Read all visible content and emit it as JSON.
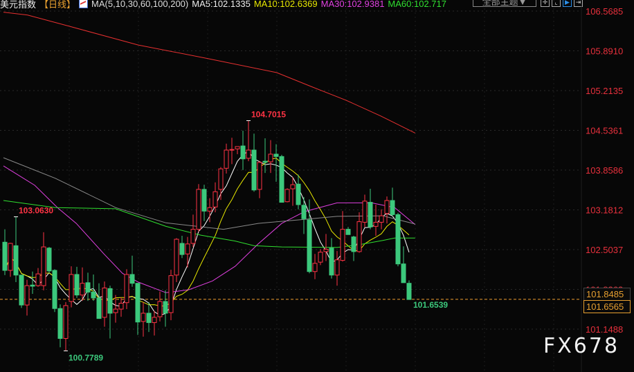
{
  "header": {
    "title": "美元指数",
    "period": "【日线】",
    "ma_icon": "ma-indicator-icon",
    "ma_params": "MA(5,10,30,60,100,200)",
    "ma5": "MA5:102.1335",
    "ma10": "MA10:102.6369",
    "ma30": "MA30:102.9381",
    "ma60": "MA60:102.717"
  },
  "toolbar": {
    "theme_select": "全部主题▼",
    "icons": [
      "crosshair-icon",
      "axis-icon",
      "play-icon",
      "expand-icon"
    ]
  },
  "price_boxes": {
    "upper": "101.8485",
    "lower": "101.6565"
  },
  "watermark": "FX678",
  "colors": {
    "up": "#ff3344",
    "down": "#3cc87c",
    "ma5": "#ffffff",
    "ma10": "#e8e800",
    "ma30": "#e040e0",
    "ma60": "#30e030",
    "ma100": "#8a8a8a",
    "ma200": "#e83030",
    "last_line": "#f0a030"
  },
  "chart_data": {
    "type": "candlestick",
    "title": "美元指数【日线】",
    "ylim": [
      100.6,
      106.62
    ],
    "y_ticks": [
      "106.5685",
      "105.8910",
      "105.2135",
      "104.5361",
      "103.8586",
      "103.1812",
      "102.5037",
      "101.8263",
      "101.1488"
    ],
    "grid": true,
    "last_price_line": 101.6565,
    "annotations": [
      {
        "text": "104.7015",
        "index": 44,
        "price": 104.7015,
        "kind": "high"
      },
      {
        "text": "103.0630",
        "index": 2,
        "price": 103.063,
        "kind": "high"
      },
      {
        "text": "100.7789",
        "index": 11,
        "price": 100.7789,
        "kind": "low"
      },
      {
        "text": "101.6539",
        "index": 73,
        "price": 101.6539,
        "kind": "last"
      }
    ],
    "ohlc": [
      [
        102.63,
        102.85,
        102.07,
        102.15
      ],
      [
        102.15,
        102.62,
        102.04,
        102.61
      ],
      [
        102.57,
        103.06,
        101.95,
        102.07
      ],
      [
        102.07,
        102.07,
        101.51,
        101.56
      ],
      [
        101.56,
        101.99,
        101.38,
        101.89
      ],
      [
        101.9,
        102.13,
        101.75,
        101.88
      ],
      [
        101.89,
        102.19,
        101.87,
        102.09
      ],
      [
        101.89,
        102.8,
        101.81,
        102.55
      ],
      [
        102.53,
        102.55,
        102.1,
        102.14
      ],
      [
        102.15,
        102.17,
        101.44,
        101.5
      ],
      [
        101.5,
        101.57,
        100.84,
        100.99
      ],
      [
        100.99,
        101.61,
        100.78,
        101.55
      ],
      [
        101.62,
        102.22,
        101.52,
        102.08
      ],
      [
        102.08,
        102.21,
        101.68,
        101.73
      ],
      [
        101.73,
        102.2,
        101.63,
        101.93
      ],
      [
        101.94,
        102.11,
        101.63,
        101.78
      ],
      [
        101.78,
        102.08,
        101.63,
        101.68
      ],
      [
        101.68,
        101.93,
        101.33,
        101.33
      ],
      [
        101.35,
        101.96,
        101.19,
        101.85
      ],
      [
        101.84,
        101.89,
        100.99,
        101.42
      ],
      [
        101.43,
        101.73,
        101.26,
        101.49
      ],
      [
        101.49,
        101.69,
        101.36,
        101.59
      ],
      [
        101.6,
        102.17,
        101.49,
        102.08
      ],
      [
        102.08,
        102.4,
        101.87,
        101.93
      ],
      [
        101.93,
        101.93,
        101.05,
        101.27
      ],
      [
        101.28,
        101.61,
        101.02,
        101.42
      ],
      [
        101.42,
        101.61,
        101.1,
        101.26
      ],
      [
        101.26,
        101.46,
        101.04,
        101.35
      ],
      [
        101.36,
        101.79,
        101.28,
        101.62
      ],
      [
        101.62,
        101.81,
        101.19,
        101.42
      ],
      [
        101.43,
        102.16,
        101.3,
        102.06
      ],
      [
        102.07,
        102.7,
        101.95,
        102.68
      ],
      [
        102.61,
        102.74,
        102.36,
        102.42
      ],
      [
        102.43,
        102.72,
        102.2,
        102.6
      ],
      [
        102.61,
        103.1,
        102.55,
        102.85
      ],
      [
        102.85,
        103.62,
        102.81,
        103.53
      ],
      [
        103.53,
        103.61,
        102.99,
        103.16
      ],
      [
        103.16,
        103.38,
        102.97,
        103.22
      ],
      [
        103.23,
        103.65,
        103.14,
        103.49
      ],
      [
        103.53,
        103.91,
        103.35,
        103.88
      ],
      [
        103.89,
        104.31,
        103.8,
        104.2
      ],
      [
        104.2,
        104.41,
        103.96,
        104.21
      ],
      [
        104.22,
        104.26,
        104.13,
        104.26
      ],
      [
        104.27,
        104.53,
        103.86,
        104.05
      ],
      [
        104.06,
        104.7,
        104.01,
        104.2
      ],
      [
        104.2,
        104.48,
        103.49,
        103.52
      ],
      [
        103.53,
        104.01,
        103.38,
        103.99
      ],
      [
        104.01,
        104.4,
        103.81,
        103.99
      ],
      [
        104.0,
        104.37,
        103.81,
        104.13
      ],
      [
        104.13,
        104.3,
        103.66,
        104.09
      ],
      [
        104.09,
        104.12,
        103.31,
        103.31
      ],
      [
        103.32,
        103.55,
        103.31,
        103.53
      ],
      [
        103.54,
        103.74,
        103.25,
        103.61
      ],
      [
        103.62,
        103.78,
        103.19,
        103.27
      ],
      [
        103.26,
        103.4,
        102.77,
        103.03
      ],
      [
        103.01,
        103.36,
        102.1,
        102.13
      ],
      [
        102.13,
        102.43,
        102.0,
        102.27
      ],
      [
        102.29,
        102.51,
        102.24,
        102.46
      ],
      [
        102.47,
        102.77,
        102.31,
        102.51
      ],
      [
        102.53,
        102.7,
        102.01,
        102.07
      ],
      [
        102.07,
        102.48,
        101.89,
        102.33
      ],
      [
        102.32,
        103.16,
        102.3,
        102.85
      ],
      [
        102.85,
        102.89,
        102.76,
        102.76
      ],
      [
        102.72,
        102.74,
        102.31,
        102.47
      ],
      [
        102.47,
        103.14,
        102.45,
        102.98
      ],
      [
        102.97,
        103.44,
        102.89,
        103.33
      ],
      [
        103.31,
        103.54,
        102.85,
        102.89
      ],
      [
        102.9,
        103.27,
        102.74,
        102.97
      ],
      [
        102.97,
        103.19,
        102.85,
        103.08
      ],
      [
        103.12,
        103.41,
        102.95,
        103.34
      ],
      [
        103.34,
        103.56,
        103.07,
        103.1
      ],
      [
        103.1,
        103.13,
        102.22,
        102.26
      ],
      [
        102.26,
        102.56,
        101.94,
        101.94
      ],
      [
        101.93,
        101.98,
        101.65,
        101.6539
      ]
    ],
    "ma_series": [
      {
        "name": "MA5",
        "period": 5,
        "color_key": "ma5"
      },
      {
        "name": "MA10",
        "period": 10,
        "color_key": "ma10"
      },
      {
        "name": "MA30",
        "color_key": "ma30",
        "points": [
          [
            -0.25,
            103.93
          ],
          [
            5.4,
            103.6
          ],
          [
            9.5,
            103.22
          ],
          [
            12.9,
            102.95
          ],
          [
            17.9,
            102.43
          ],
          [
            21.25,
            102.1
          ],
          [
            24.1,
            101.95
          ],
          [
            29.1,
            101.77
          ],
          [
            33.25,
            101.82
          ],
          [
            37.5,
            101.97
          ],
          [
            41.6,
            102.22
          ],
          [
            45.75,
            102.6
          ],
          [
            50,
            102.95
          ],
          [
            54.1,
            103.15
          ],
          [
            60,
            103.3
          ],
          [
            66.25,
            103.3
          ],
          [
            70.4,
            103.22
          ],
          [
            74.1,
            102.93
          ]
        ]
      },
      {
        "name": "MA60",
        "color_key": "ma60",
        "points": [
          [
            -0.25,
            103.34
          ],
          [
            9.1,
            103.22
          ],
          [
            20,
            103.2
          ],
          [
            29.1,
            102.9
          ],
          [
            35.4,
            102.75
          ],
          [
            41.6,
            102.65
          ],
          [
            45,
            102.57
          ],
          [
            50,
            102.55
          ],
          [
            60,
            102.54
          ],
          [
            64.1,
            102.59
          ],
          [
            68.25,
            102.66
          ],
          [
            70.4,
            102.7
          ],
          [
            74.1,
            102.7
          ]
        ]
      },
      {
        "name": "MA100",
        "color_key": "ma100",
        "points": [
          [
            -0.25,
            104.07
          ],
          [
            9.1,
            103.72
          ],
          [
            20,
            103.22
          ],
          [
            29.1,
            102.96
          ],
          [
            39.5,
            102.85
          ],
          [
            45.75,
            102.95
          ],
          [
            54.1,
            103.02
          ],
          [
            60,
            103.07
          ],
          [
            68.25,
            103.08
          ],
          [
            74.1,
            102.94
          ]
        ]
      },
      {
        "name": "MA200",
        "color_key": "ma200",
        "points": [
          [
            -0.25,
            106.55
          ],
          [
            4.1,
            106.5
          ],
          [
            11.6,
            106.31
          ],
          [
            24.1,
            105.99
          ],
          [
            36.6,
            105.76
          ],
          [
            49.1,
            105.52
          ],
          [
            55.4,
            105.28
          ],
          [
            61.6,
            105.05
          ],
          [
            67.9,
            104.78
          ],
          [
            74.1,
            104.49
          ]
        ]
      }
    ]
  }
}
